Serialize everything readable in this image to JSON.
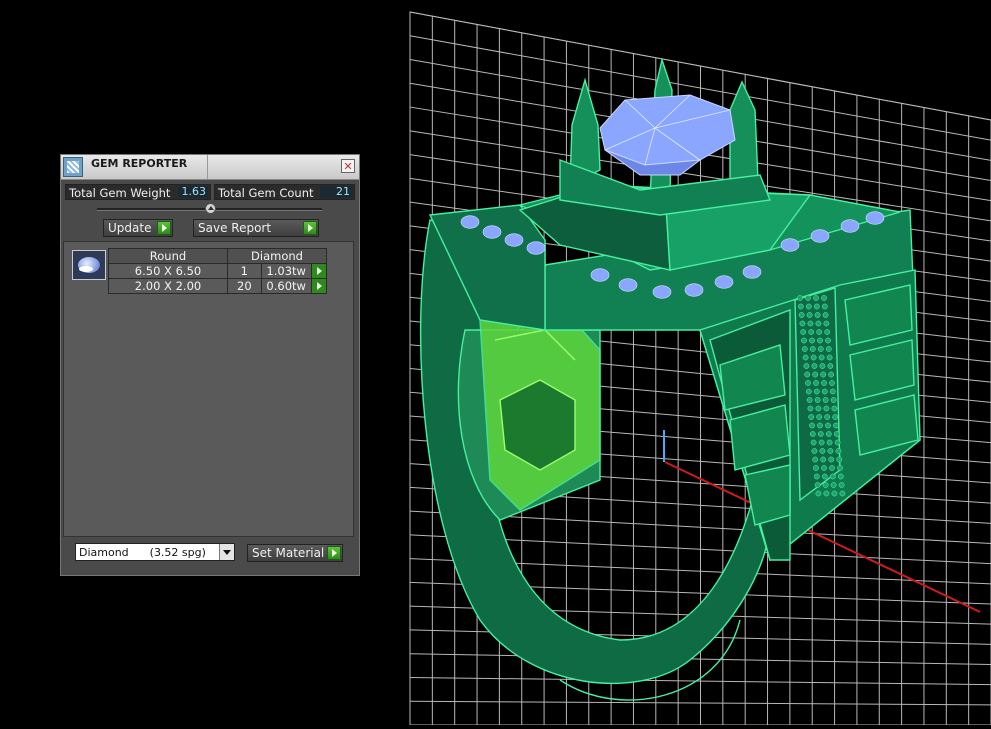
{
  "panel": {
    "title": "GEM REPORTER",
    "close_glyph": "✕",
    "total_gem_weight_label": "Total Gem Weight",
    "total_gem_weight_value": "1.63",
    "total_gem_count_label": "Total Gem Count",
    "total_gem_count_value": "21",
    "update_label": "Update",
    "save_report_label": "Save Report",
    "report": {
      "shape_header": "Round",
      "material_header": "Diamond",
      "rows": [
        {
          "size": "6.50 X 6.50",
          "count": "1",
          "weight": "1.03tw"
        },
        {
          "size": "2.00 X 2.00",
          "count": "20",
          "weight": "0.60tw"
        }
      ]
    },
    "material_select_value": "Diamond      (3.52 spg)",
    "set_material_label": "Set Material"
  },
  "colors": {
    "ring_green": "#12774a",
    "ring_edge": "#3fe79a",
    "gem_blue": "#8aa6ff",
    "inner_glow": "#7fff4a",
    "grid_line": "#d8d8d8",
    "axis_red": "#d01b1b",
    "accent_green_button": "#3aa526"
  },
  "icons": [
    "gem-reporter-app-icon",
    "close-icon",
    "slider-knob-icon",
    "play-arrow-icon",
    "round-gem-icon",
    "dropdown-arrow-icon"
  ]
}
